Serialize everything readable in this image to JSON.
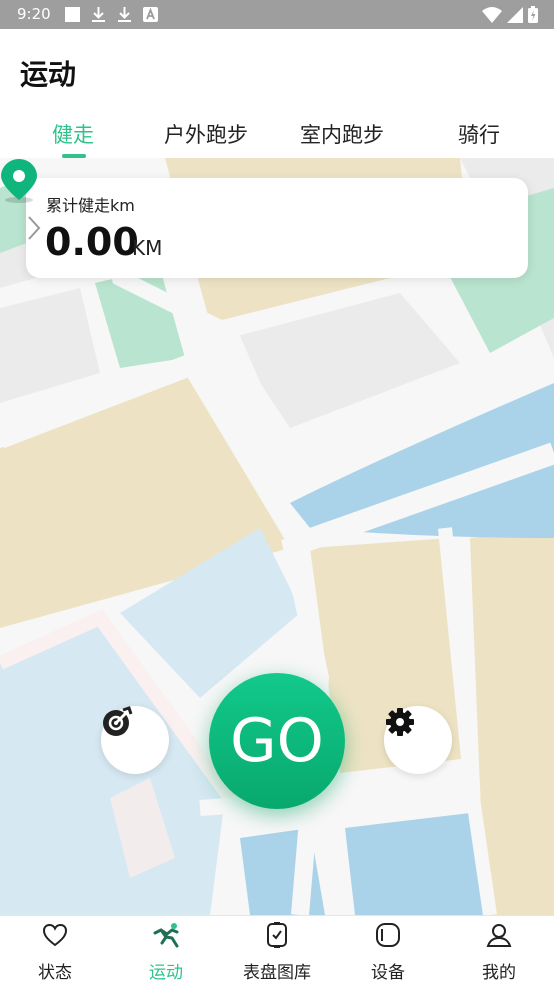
{
  "status_bar": {
    "time": "9:20",
    "left_icons": [
      "stop-square-icon",
      "download-icon",
      "download-icon",
      "text-a-icon"
    ],
    "right_icons": [
      "wifi-icon",
      "signal-icon",
      "battery-icon"
    ]
  },
  "header": {
    "title": "运动",
    "tabs": [
      {
        "label": "健走",
        "active": true
      },
      {
        "label": "户外跑步",
        "active": false
      },
      {
        "label": "室内跑步",
        "active": false
      },
      {
        "label": "骑行",
        "active": false
      }
    ]
  },
  "summary_card": {
    "label": "累计健走km",
    "value": "0.00",
    "unit": "KM"
  },
  "actions": {
    "go_label": "GO",
    "left_button_icon": "target-icon",
    "right_button_icon": "gear-icon"
  },
  "bottom_nav": {
    "items": [
      {
        "label": "状态",
        "icon": "heart-icon",
        "active": false
      },
      {
        "label": "运动",
        "icon": "running-icon",
        "active": true
      },
      {
        "label": "表盘图库",
        "icon": "watchface-icon",
        "active": false
      },
      {
        "label": "设备",
        "icon": "watch-device-icon",
        "active": false
      },
      {
        "label": "我的",
        "icon": "person-icon",
        "active": false
      }
    ]
  },
  "colors": {
    "accent": "#2fc38b",
    "status_bar": "#9e9e9e",
    "go_gradient_top": "#12c98b",
    "go_gradient_bottom": "#08a86e",
    "map_road": "#f7f7f7",
    "map_water": "#aad3ea",
    "map_park": "#b9e4cf",
    "map_sand": "#ede3c4",
    "map_block": "#ebebeb"
  }
}
